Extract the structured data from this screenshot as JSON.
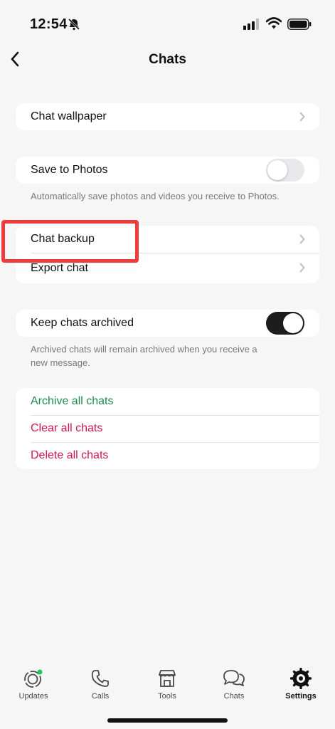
{
  "status_bar": {
    "time": "12:54"
  },
  "header": {
    "title": "Chats"
  },
  "sections": {
    "wallpaper": {
      "label": "Chat wallpaper"
    },
    "save_photos": {
      "label": "Save to Photos",
      "toggle_on": false,
      "footer": "Automatically save photos and videos you receive to Photos."
    },
    "backup": {
      "chat_backup": "Chat backup",
      "export_chat": "Export chat"
    },
    "archived": {
      "label": "Keep chats archived",
      "toggle_on": true,
      "footer": "Archived chats will remain archived when you receive a new message."
    },
    "actions": {
      "archive_all": "Archive all chats",
      "clear_all": "Clear all chats",
      "delete_all": "Delete all chats"
    }
  },
  "tabbar": {
    "updates": "Updates",
    "calls": "Calls",
    "tools": "Tools",
    "chats": "Chats",
    "settings": "Settings",
    "active": "settings"
  },
  "colors": {
    "green": "#1d8a4e",
    "red": "#cf1849",
    "highlight": "#ee3b3b",
    "background": "#f6f6f6"
  }
}
